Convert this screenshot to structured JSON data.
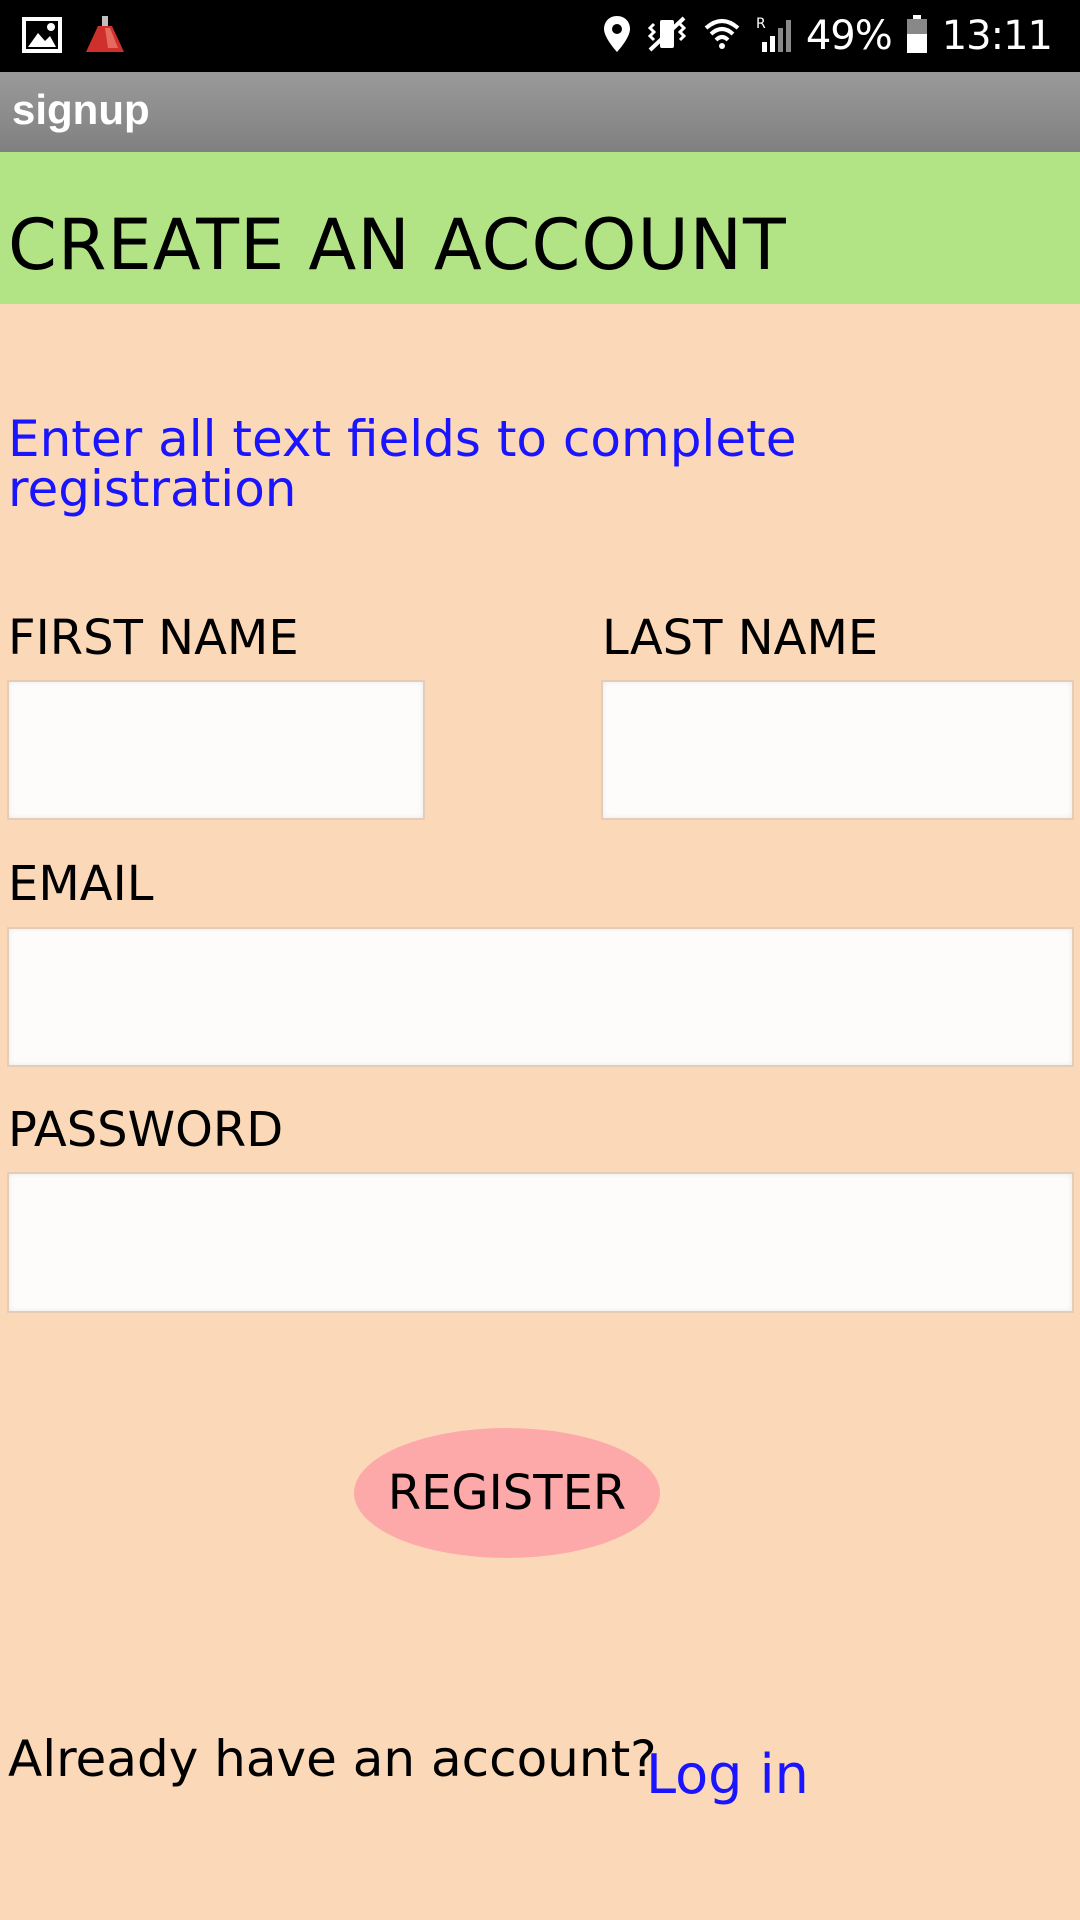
{
  "status_bar": {
    "battery_percent": "49%",
    "time": "13:11",
    "icons_left": [
      "image-icon",
      "app-notification-icon"
    ],
    "icons_right": [
      "location-icon",
      "vibrate-icon",
      "wifi-icon",
      "signal-icon",
      "battery-icon"
    ]
  },
  "app_bar": {
    "title": "signup"
  },
  "header": {
    "title": "CREATE AN ACCOUNT",
    "background": "#b2e485"
  },
  "instructions": "Enter all text fields to complete registration",
  "form": {
    "first_name_label": "FIRST NAME",
    "first_name_value": "",
    "last_name_label": "LAST NAME",
    "last_name_value": "",
    "email_label": "EMAIL",
    "email_value": "",
    "password_label": "PASSWORD",
    "password_value": ""
  },
  "register_button": {
    "label": "REGISTER",
    "color": "#fda9aa"
  },
  "footer": {
    "prompt": "Already have an account?",
    "login_link": "Log in"
  },
  "colors": {
    "page_background": "#fbd9b8",
    "link": "#1a14ff"
  }
}
